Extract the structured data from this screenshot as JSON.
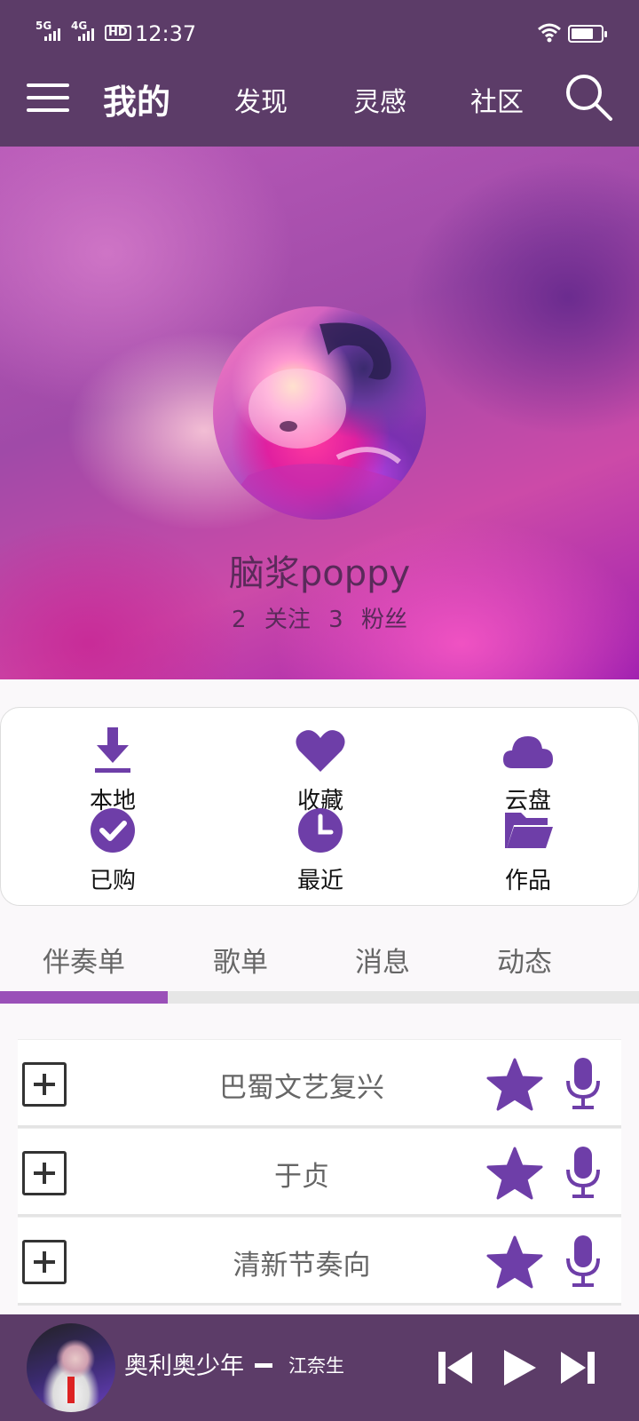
{
  "status_bar": {
    "sim1": "5G",
    "sim2": "4G",
    "hd": "HD",
    "time": "12:37",
    "battery_level": 0.75
  },
  "top_nav": {
    "tabs": [
      {
        "label": "我的",
        "active": true
      },
      {
        "label": "发现",
        "active": false
      },
      {
        "label": "灵感",
        "active": false
      },
      {
        "label": "社区",
        "active": false
      }
    ],
    "icons": {
      "menu": "menu-icon",
      "search": "search-icon"
    }
  },
  "profile": {
    "username": "脑浆poppy",
    "following_count": "2",
    "following_label": "关注",
    "followers_count": "3",
    "followers_label": "粉丝"
  },
  "quick_actions": [
    {
      "label": "本地",
      "icon": "download-icon"
    },
    {
      "label": "收藏",
      "icon": "heart-icon"
    },
    {
      "label": "云盘",
      "icon": "cloud-icon"
    },
    {
      "label": "已购",
      "icon": "check-circle-icon"
    },
    {
      "label": "最近",
      "icon": "clock-icon"
    },
    {
      "label": "作品",
      "icon": "folder-icon"
    }
  ],
  "content_tabs": {
    "tabs": [
      "伴奏单",
      "歌单",
      "消息",
      "动态"
    ],
    "active_index": 0
  },
  "accompaniment_list": [
    {
      "title": "巴蜀文艺复兴"
    },
    {
      "title": "于贞"
    },
    {
      "title": "清新节奏向"
    }
  ],
  "player": {
    "song": "奥利奥少年",
    "artist": "江奈生"
  },
  "colors": {
    "header_bg": "#5c3c68",
    "accent": "#6e3ea8",
    "tab_indicator": "#9a50b8"
  }
}
